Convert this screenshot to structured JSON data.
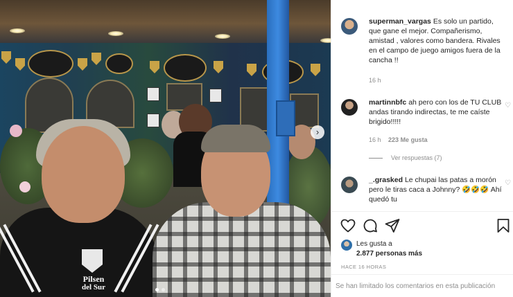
{
  "photo": {
    "jersey_text": [
      "Pilsen",
      "del Sur"
    ],
    "carousel_next_icon": "chevron-right-icon",
    "carousel": {
      "count": 2,
      "active_index": 0
    }
  },
  "comments": [
    {
      "username": "superman_vargas",
      "text": "Es solo un partido, que gane el mejor. Compañerismo, amistad , valores como bandera. Rivales en el campo de juego amigos fuera de la cancha !!",
      "time": "16 h",
      "likes": "",
      "has_heart": false
    },
    {
      "username": "martinnbfc",
      "text": "ah pero con los de TU CLUB andas tirando indirectas, te me caíste brigido!!!!!",
      "time": "16 h",
      "likes": "223 Me gusta",
      "has_heart": true,
      "replies": "Ver respuestas (7)"
    },
    {
      "username": "_.grasked",
      "text": "Le chupai las patas a morón pero le tiras caca a Johnny? 🤣🤣🤣 Ahí quedó tu",
      "time": "",
      "likes": "",
      "has_heart": true
    }
  ],
  "actions": {
    "like_icon": "heart-icon",
    "comment_icon": "comment-icon",
    "share_icon": "send-icon",
    "save_icon": "bookmark-icon"
  },
  "likes": {
    "prefix": "Les gusta a",
    "count_text": "2.877 personas más"
  },
  "time_ago": "HACE 16 HORAS",
  "comments_limited": "Se han limitado los comentarios en esta publicación",
  "colors": {
    "text": "#262626",
    "muted": "#8e8e8e",
    "border": "#efefef",
    "pole_blue": "#3d8ae0"
  }
}
